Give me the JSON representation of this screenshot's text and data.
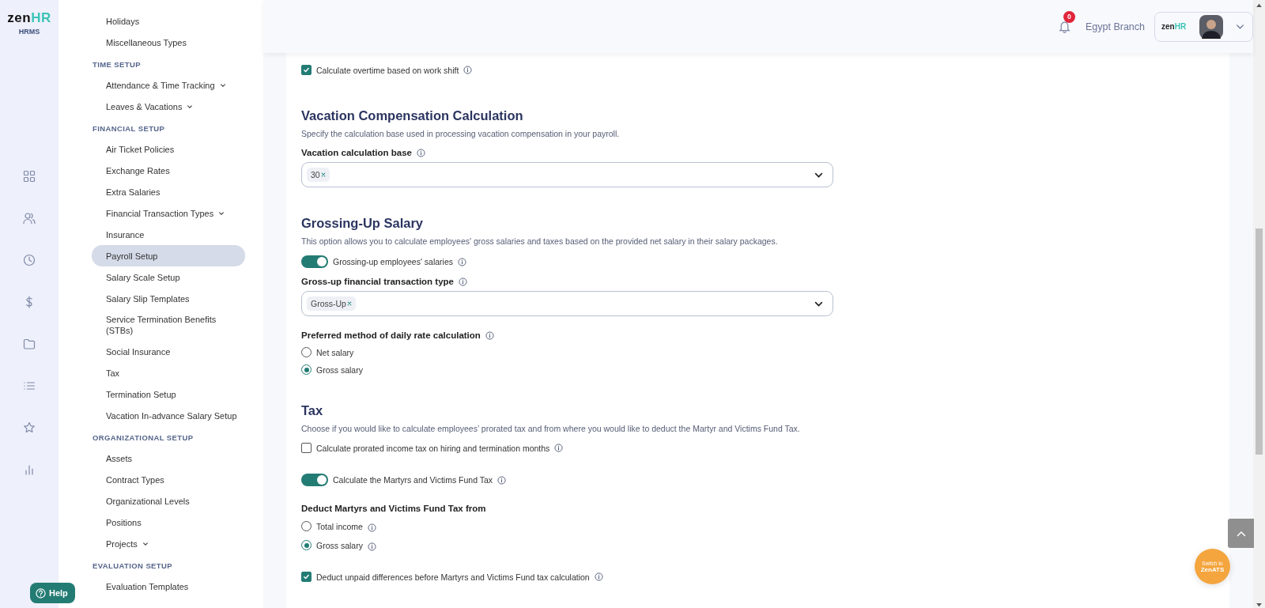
{
  "brand": {
    "name_a": "zen",
    "name_b": "HR",
    "product": "HRMS"
  },
  "sidebar": {
    "groups": [
      {
        "items": [
          {
            "label": "Holidays",
            "expandable": false,
            "selected": false
          },
          {
            "label": "Miscellaneous Types",
            "expandable": false,
            "selected": false
          }
        ]
      },
      {
        "title": "TIME SETUP",
        "items": [
          {
            "label": "Attendance & Time Tracking",
            "expandable": true,
            "selected": false
          },
          {
            "label": "Leaves & Vacations",
            "expandable": true,
            "selected": false
          }
        ]
      },
      {
        "title": "FINANCIAL SETUP",
        "items": [
          {
            "label": "Air Ticket Policies",
            "expandable": false,
            "selected": false
          },
          {
            "label": "Exchange Rates",
            "expandable": false,
            "selected": false
          },
          {
            "label": "Extra Salaries",
            "expandable": false,
            "selected": false
          },
          {
            "label": "Financial Transaction Types",
            "expandable": true,
            "selected": false
          },
          {
            "label": "Insurance",
            "expandable": false,
            "selected": false
          },
          {
            "label": "Payroll Setup",
            "expandable": false,
            "selected": true
          },
          {
            "label": "Salary Scale Setup",
            "expandable": false,
            "selected": false
          },
          {
            "label": "Salary Slip Templates",
            "expandable": false,
            "selected": false
          },
          {
            "label": "Service Termination Benefits (STBs)",
            "expandable": false,
            "selected": false
          },
          {
            "label": "Social Insurance",
            "expandable": false,
            "selected": false
          },
          {
            "label": "Tax",
            "expandable": false,
            "selected": false
          },
          {
            "label": "Termination Setup",
            "expandable": false,
            "selected": false
          },
          {
            "label": "Vacation In-advance Salary Setup",
            "expandable": false,
            "selected": false
          }
        ]
      },
      {
        "title": "ORGANIZATIONAL SETUP",
        "items": [
          {
            "label": "Assets",
            "expandable": false,
            "selected": false
          },
          {
            "label": "Contract Types",
            "expandable": false,
            "selected": false
          },
          {
            "label": "Organizational Levels",
            "expandable": false,
            "selected": false
          },
          {
            "label": "Positions",
            "expandable": false,
            "selected": false
          },
          {
            "label": "Projects",
            "expandable": true,
            "selected": false
          }
        ]
      },
      {
        "title": "EVALUATION SETUP",
        "items": [
          {
            "label": "Evaluation Templates",
            "expandable": false,
            "selected": false
          }
        ]
      }
    ]
  },
  "help": "Help",
  "header": {
    "notifications": "0",
    "branch": "Egypt Branch",
    "account_logo": {
      "a": "zen",
      "b": "HR"
    }
  },
  "sections": [
    {
      "controls": [
        {
          "kind": "checkbox",
          "label": "Calculate overtime based on work shift",
          "checked": true,
          "info": true
        }
      ]
    },
    {
      "title": "Vacation Compensation Calculation",
      "description": "Specify the calculation base used in processing vacation compensation in your payroll.",
      "controls": [
        {
          "kind": "select",
          "label": "Vacation calculation base",
          "info": true,
          "tags": [
            "30"
          ]
        }
      ]
    },
    {
      "title": "Grossing-Up Salary",
      "description": "This option allows you to calculate employees' gross salaries and taxes based on the provided net salary in their salary packages.",
      "controls": [
        {
          "kind": "toggle",
          "label": "Grossing-up employees' salaries",
          "on": true,
          "info": true
        },
        {
          "kind": "select",
          "label": "Gross-up financial transaction type",
          "info": true,
          "tags": [
            "Gross-Up"
          ]
        },
        {
          "kind": "radio",
          "label": "Preferred method of daily rate calculation",
          "info": true,
          "options": [
            {
              "label": "Net salary",
              "selected": false,
              "info": false
            },
            {
              "label": "Gross salary",
              "selected": true,
              "info": false
            }
          ]
        }
      ]
    },
    {
      "title": "Tax",
      "description": "Choose if you would like to calculate employees’ prorated tax and from where you would like to deduct the Martyr and Victims Fund Tax.",
      "controls": [
        {
          "kind": "checkbox",
          "label": "Calculate prorated income tax on hiring and termination months",
          "checked": false,
          "info": true
        },
        {
          "kind": "toggle",
          "label": "Calculate the Martyrs and Victims Fund Tax",
          "on": true,
          "info": true
        },
        {
          "kind": "radio",
          "label": "Deduct Martyrs and Victims Fund Tax from",
          "info": false,
          "options": [
            {
              "label": "Total income",
              "selected": false,
              "info": true
            },
            {
              "label": "Gross salary",
              "selected": true,
              "info": true
            }
          ]
        },
        {
          "kind": "checkbox",
          "label": "Deduct unpaid differences before Martyrs and Victims Fund tax calculation",
          "checked": true,
          "info": true
        }
      ]
    }
  ],
  "switch_button": {
    "line1": "Switch to",
    "line2": "ZenATS"
  }
}
